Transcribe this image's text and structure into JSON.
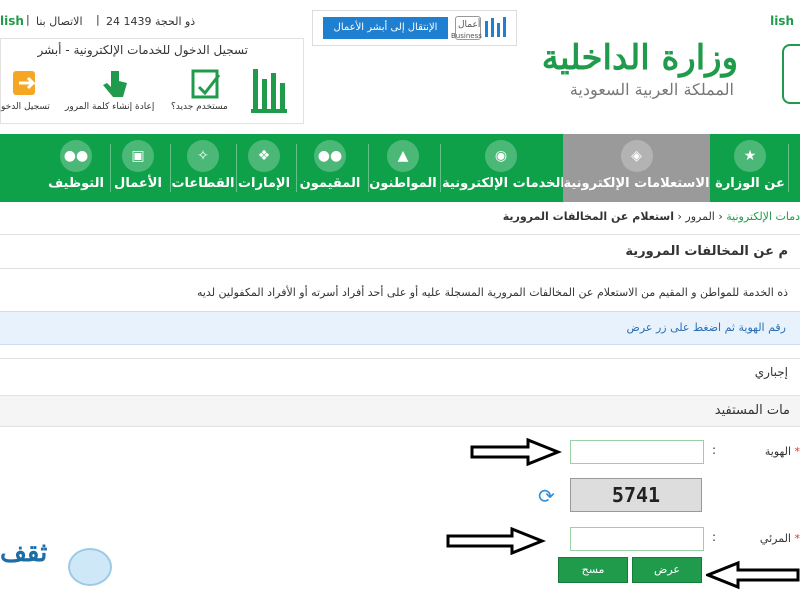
{
  "topbar": {
    "date": "24 ذو الحجة 1439",
    "contact": "الاتصال بنا",
    "lang": "lish"
  },
  "business": {
    "button": "الإنتقال إلى أبشر الأعمال",
    "brand_ar": "أعمال",
    "brand_en": "Business"
  },
  "login": {
    "title": "تسجيل الدخول للخدمات الإلكترونية - أبشر",
    "items": [
      {
        "label": "مستخدم جديد؟"
      },
      {
        "label": "إعادة إنشاء كلمة المرور"
      },
      {
        "label": "تسجيل الدخو"
      }
    ],
    "logo": "أبشر"
  },
  "logo": {
    "title": "وزارة الداخلية",
    "subtitle": "المملكة العربية السعودية"
  },
  "nav": {
    "items": [
      {
        "label": "التوظيف"
      },
      {
        "label": "الأعمال"
      },
      {
        "label": "القطاعات"
      },
      {
        "label": "الإمارات"
      },
      {
        "label": "المقيمون"
      },
      {
        "label": "المواطنون"
      },
      {
        "label": "الخدمات الإلكترونية"
      },
      {
        "label": "الاستعلامات الإلكترونية"
      },
      {
        "label": "عن الوزارة"
      }
    ]
  },
  "breadcrumb": {
    "root": "دمات الإلكترونية",
    "mid": "المرور",
    "current": "استعلام عن المخالفات المرورية"
  },
  "page": {
    "title": "م عن المخالفات المرورية",
    "desc": "ذه الخدمة للمواطن و المقيم من الاستعلام عن المخالفات المرورية المسجلة عليه أو على أحد أفراد أسرته أو الأفراد المكفولين لديه",
    "info": "رقم الهوية ثم اضغط على زر عرض",
    "option": "إجباري",
    "section": "مات المستفيد"
  },
  "form": {
    "id_label": "الهوية",
    "id_value": "",
    "captcha_text": "5741",
    "code_label": "المرئي",
    "code_value": "",
    "colon": ":",
    "required": "*",
    "submit": "عرض",
    "clear": "مسح"
  },
  "watermark": "ثقف"
}
